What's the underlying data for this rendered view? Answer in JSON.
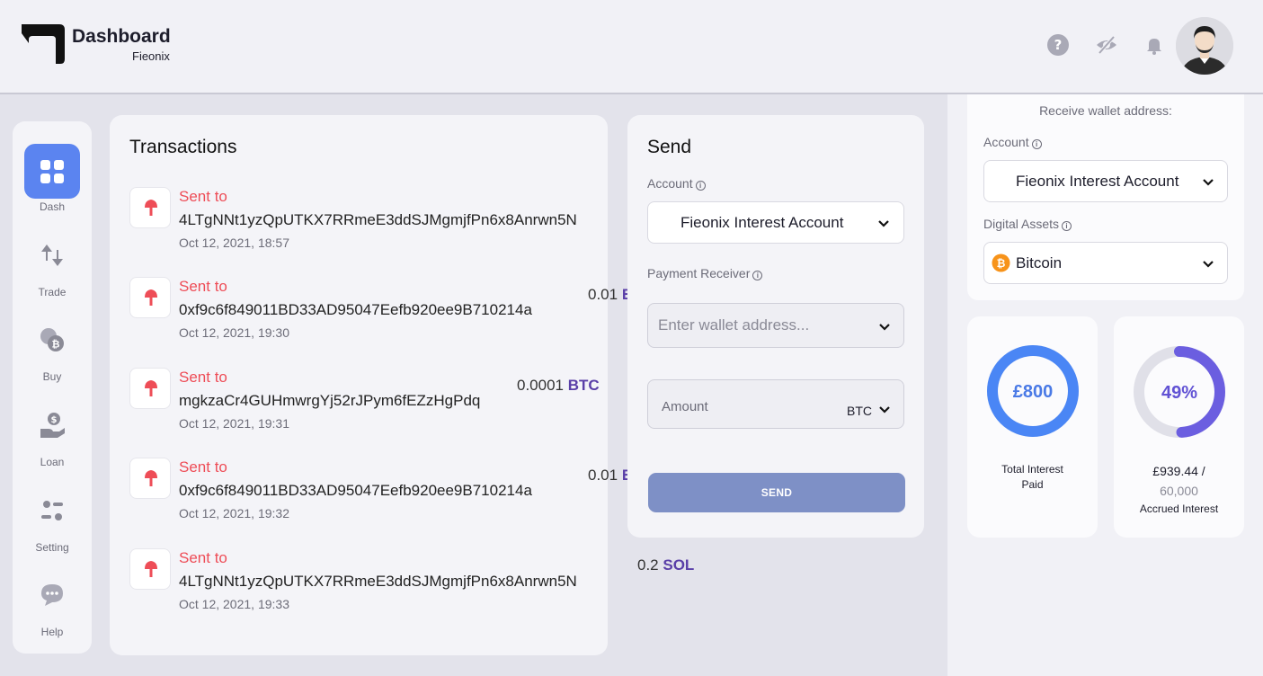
{
  "header": {
    "title": "Dashboard",
    "subtitle": "Fieonix",
    "icons": [
      "help-icon",
      "eye-off-icon",
      "bell-icon"
    ],
    "avatar": "user-avatar"
  },
  "sidebar": {
    "items": [
      {
        "label": "Dash",
        "icon": "dashboard-grid-icon",
        "active": true
      },
      {
        "label": "Trade",
        "icon": "trade-icon"
      },
      {
        "label": "Buy",
        "icon": "coins-icon"
      },
      {
        "label": "Loan",
        "icon": "loan-hand-icon"
      },
      {
        "label": "Setting",
        "icon": "sliders-icon"
      },
      {
        "label": "Help",
        "icon": "chat-icon"
      }
    ]
  },
  "transactions": {
    "title": "Transactions",
    "items": [
      {
        "status": "Sent to",
        "address": "4LTgNNt1yzQpUTKX7RRmeE3ddSJMgmjfPn6x8Anrwn5N",
        "date": "Oct 12, 2021, 18:57"
      },
      {
        "status": "Sent to",
        "address": "0xf9c6f849011BD33AD95047Eefb920ee9B710214a",
        "date": "Oct 12, 2021, 19:30"
      },
      {
        "status": "Sent to",
        "address": "mgkzaCr4GUHmwrgYj52rJPym6fEZzHgPdq",
        "date": "Oct 12, 2021, 19:31"
      },
      {
        "status": "Sent to",
        "address": "0xf9c6f849011BD33AD95047Eefb920ee9B710214a",
        "date": "Oct 12, 2021, 19:32"
      },
      {
        "status": "Sent to",
        "address": "4LTgNNt1yzQpUTKX7RRmeE3ddSJMgmjfPn6x8Anrwn5N",
        "date": "Oct 12, 2021, 19:33"
      }
    ],
    "amounts": [
      {
        "value": "0.01",
        "currency": "E"
      },
      {
        "value": "0.0001",
        "currency": "BTC"
      },
      {
        "value": "0.01",
        "currency": "E"
      },
      {
        "value": "0.2",
        "currency": "SOL"
      }
    ]
  },
  "send": {
    "title": "Send",
    "account_label": "Account",
    "account_value": "Fieonix Interest Account",
    "receiver_label": "Payment Receiver",
    "receiver_placeholder": "Enter wallet address...",
    "amount_label": "Amount",
    "amount_currency": "BTC",
    "button": "SEND"
  },
  "receive": {
    "title": "Receive wallet address:",
    "account_label": "Account",
    "account_value": "Fieonix Interest Account",
    "assets_label": "Digital Assets",
    "asset_value": "Bitcoin"
  },
  "stats": {
    "interest_paid": {
      "value": "£800",
      "caption_line1": "Total Interest",
      "caption_line2": "Paid",
      "ring_fraction": 1.0,
      "color": "#4a86f5"
    },
    "accrued": {
      "value": "49%",
      "amount": "£939.44 /",
      "total": "60,000",
      "caption": "Accrued Interest",
      "ring_fraction": 0.49,
      "color": "#6b5ee0"
    }
  },
  "colors": {
    "accent": "#5b84f0",
    "sent": "#ee4d57",
    "currency": "#5a3fa8",
    "send_button": "#7e90c6"
  }
}
